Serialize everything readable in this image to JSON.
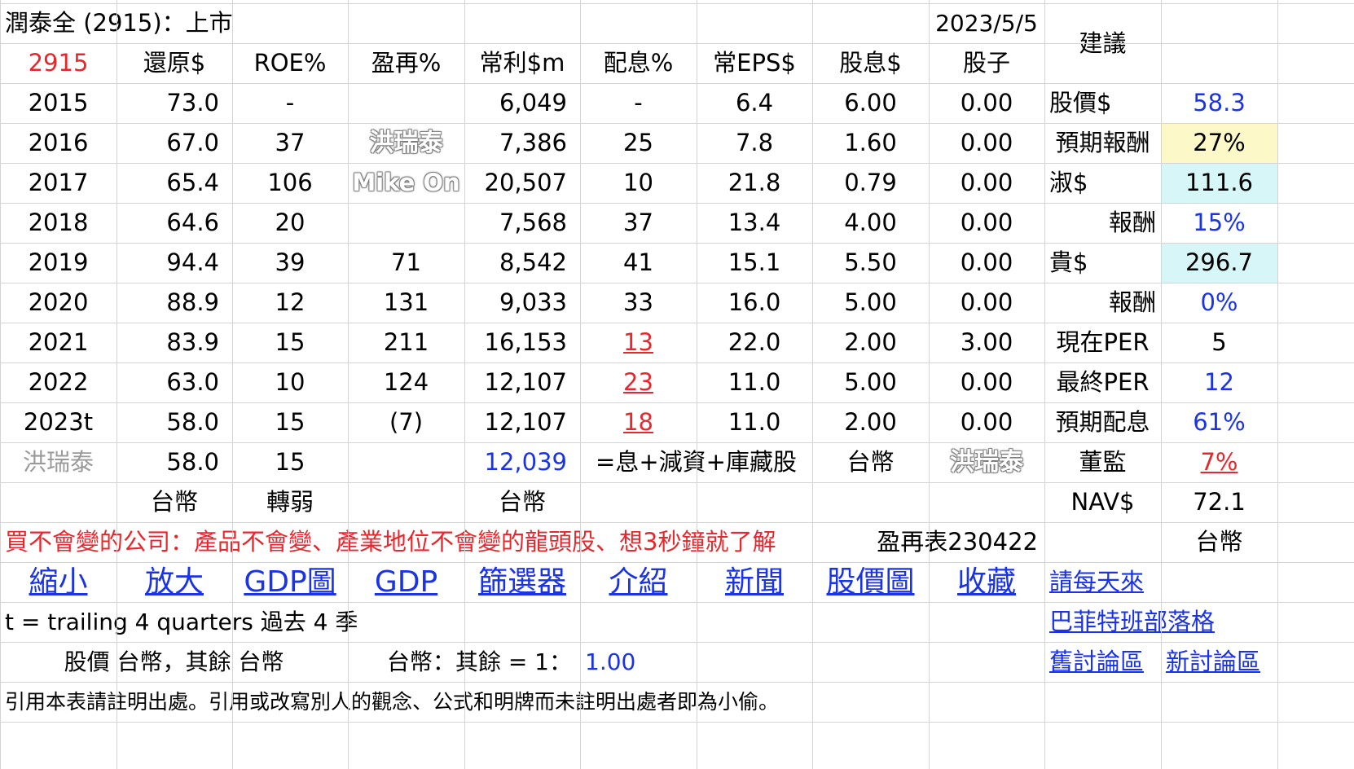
{
  "header": {
    "title": "潤泰全 (2915)：上市",
    "date": "2023/5/5",
    "advice": "建議"
  },
  "columns": [
    "2915",
    "還原$",
    "ROE%",
    "盈再%",
    "常利$m",
    "配息%",
    "常EPS$",
    "股息$",
    "股子"
  ],
  "rows": [
    {
      "year": "2015",
      "restore": "73.0",
      "roe": "-",
      "reinvest": "",
      "profit": "6,049",
      "payout": "-",
      "eps": "6.4",
      "dividend": "6.00",
      "stock": "0.00"
    },
    {
      "year": "2016",
      "restore": "67.0",
      "roe": "37",
      "reinvest": "",
      "profit": "7,386",
      "payout": "25",
      "eps": "7.8",
      "dividend": "1.60",
      "stock": "0.00"
    },
    {
      "year": "2017",
      "restore": "65.4",
      "roe": "106",
      "reinvest": "",
      "profit": "20,507",
      "payout": "10",
      "eps": "21.8",
      "dividend": "0.79",
      "stock": "0.00"
    },
    {
      "year": "2018",
      "restore": "64.6",
      "roe": "20",
      "reinvest": "",
      "profit": "7,568",
      "payout": "37",
      "eps": "13.4",
      "dividend": "4.00",
      "stock": "0.00"
    },
    {
      "year": "2019",
      "restore": "94.4",
      "roe": "39",
      "reinvest": "71",
      "profit": "8,542",
      "payout": "41",
      "eps": "15.1",
      "dividend": "5.50",
      "stock": "0.00"
    },
    {
      "year": "2020",
      "restore": "88.9",
      "roe": "12",
      "reinvest": "131",
      "profit": "9,033",
      "payout": "33",
      "eps": "16.0",
      "dividend": "5.00",
      "stock": "0.00"
    },
    {
      "year": "2021",
      "restore": "83.9",
      "roe": "15",
      "reinvest": "211",
      "profit": "16,153",
      "payout": "13",
      "eps": "22.0",
      "dividend": "2.00",
      "stock": "3.00"
    },
    {
      "year": "2022",
      "restore": "63.0",
      "roe": "10",
      "reinvest": "124",
      "profit": "12,107",
      "payout": "23",
      "eps": "11.0",
      "dividend": "5.00",
      "stock": "0.00"
    },
    {
      "year": "2023t",
      "restore": "58.0",
      "roe": "15",
      "reinvest": "(7)",
      "profit": "12,107",
      "payout": "18",
      "eps": "11.0",
      "dividend": "2.00",
      "stock": "0.00"
    }
  ],
  "summary_row": {
    "author": "洪瑞泰",
    "restore": "58.0",
    "roe": "15",
    "profit": "12,039",
    "note": "=息+減資+庫藏股",
    "currency": "台幣"
  },
  "unit_row": {
    "restore": "台幣",
    "roe": "轉弱",
    "profit": "台幣"
  },
  "watermarks": {
    "name": "洪瑞泰",
    "handle": "Mike On"
  },
  "advice_panel": [
    {
      "label": "股價$",
      "value": "58.3"
    },
    {
      "label": "預期報酬",
      "value": "27%"
    },
    {
      "label": "淑$",
      "value": "111.6"
    },
    {
      "label": "報酬",
      "value": "15%"
    },
    {
      "label": "貴$",
      "value": "296.7"
    },
    {
      "label": "報酬",
      "value": "0%"
    },
    {
      "label": "現在PER",
      "value": "5"
    },
    {
      "label": "最終PER",
      "value": "12"
    },
    {
      "label": "預期配息",
      "value": "61%"
    },
    {
      "label": "董監",
      "value": "7%"
    },
    {
      "label": "NAV$",
      "value": "72.1"
    }
  ],
  "slogan": "買不會變的公司：產品不會變、產業地位不會變的龍頭股、想3秒鐘就了解",
  "table_ref": "盈再表230422",
  "panel_currency": "台幣",
  "links": [
    "縮小",
    "放大",
    "GDP圖",
    "GDP",
    "篩選器",
    "介紹",
    "新聞",
    "股價圖",
    "收藏"
  ],
  "side_links": [
    "請每天來",
    "巴菲特班部落格",
    "舊討論區",
    "新討論區"
  ],
  "trailing_note": "t = trailing 4 quarters 過去 4 季",
  "price_note": "股價 台幣，其餘 台幣",
  "rate_note": "台幣：其餘 = 1：",
  "rate_value": "1.00",
  "footer": "引用本表請註明出處。引用或改寫別人的觀念、公式和明牌而未註明出處者即為小偷。",
  "colors": {
    "red": "#e8272c",
    "blue": "#1a33e6",
    "yellow": "#fcf8c8",
    "cyan": "#d6f6f8",
    "grid": "#d4d4d4"
  }
}
